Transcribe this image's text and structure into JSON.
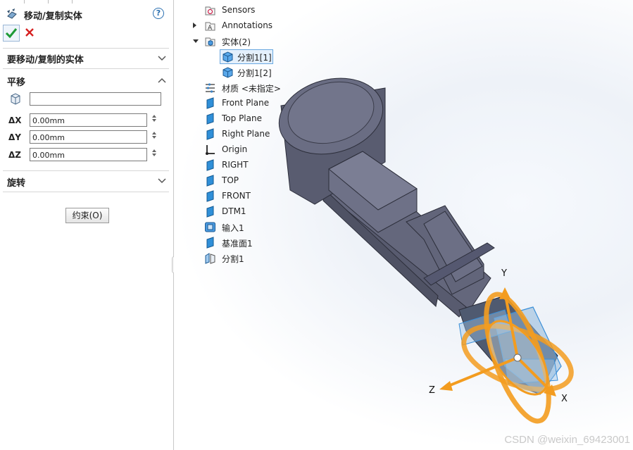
{
  "property_manager": {
    "title": "移动/复制实体",
    "help_icon": "?",
    "ok_icon": "check-icon",
    "cancel_icon": "close-icon",
    "section_bodies": "要移动/复制的实体",
    "section_translate": "平移",
    "translate_ref_value": "",
    "dx_label": "ΔX",
    "dy_label": "ΔY",
    "dz_label": "ΔZ",
    "dx_value": "0.00mm",
    "dy_value": "0.00mm",
    "dz_value": "0.00mm",
    "section_rotate": "旋转",
    "constraints_button": "约束(O)"
  },
  "tree": {
    "items": [
      {
        "label": "Sensors",
        "icon": "sensors-icon"
      },
      {
        "label": "Annotations",
        "icon": "annotations-icon"
      },
      {
        "label": "实体(2)",
        "icon": "bodies-folder-icon"
      },
      {
        "label": "分割1[1]",
        "icon": "solid-body-icon"
      },
      {
        "label": "分割1[2]",
        "icon": "solid-body-icon"
      },
      {
        "label": "材质 <未指定>",
        "icon": "material-icon"
      },
      {
        "label": "Front Plane",
        "icon": "plane-icon"
      },
      {
        "label": "Top Plane",
        "icon": "plane-icon"
      },
      {
        "label": "Right Plane",
        "icon": "plane-icon"
      },
      {
        "label": "Origin",
        "icon": "origin-icon"
      },
      {
        "label": "RIGHT",
        "icon": "plane-icon"
      },
      {
        "label": "TOP",
        "icon": "plane-icon"
      },
      {
        "label": "FRONT",
        "icon": "plane-icon"
      },
      {
        "label": "DTM1",
        "icon": "plane-icon"
      },
      {
        "label": "输入1",
        "icon": "import-icon"
      },
      {
        "label": "基准面1",
        "icon": "plane-icon"
      },
      {
        "label": "分割1",
        "icon": "split-icon"
      }
    ]
  },
  "triad": {
    "x_label": "X",
    "y_label": "Y",
    "z_label": "Z"
  },
  "watermark": "CSDN @weixin_69423001",
  "colors": {
    "triad": "#f39c1f",
    "model": "#5f6277",
    "selection": "#6aa8e0"
  }
}
